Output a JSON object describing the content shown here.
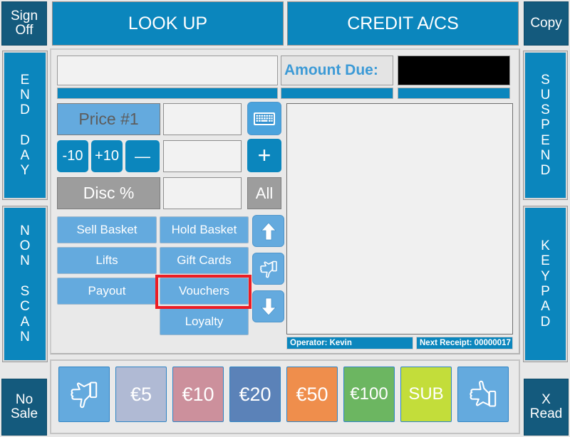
{
  "app": {
    "title": "POS Terminal",
    "colors": {
      "primary_blue": "#0b86bd",
      "light_blue": "#64aade",
      "dark_navy": "#145a7d",
      "disabled_gray": "#9d9d9d",
      "highlight_red": "#ed1c24",
      "panel_gray": "#e9e9e9"
    }
  },
  "corners": {
    "sign_off": "Sign Off",
    "copy": "Copy",
    "no_sale": "No Sale",
    "x_read": "X Read"
  },
  "topbar": {
    "look_up": "LOOK UP",
    "credit_acs": "CREDIT A/CS"
  },
  "sidebar_left": {
    "end_day": "END DAY",
    "non_scan": "NON SCAN"
  },
  "sidebar_right": {
    "suspend": "SUSPEND",
    "keypad": "KEYPAD"
  },
  "entry": {
    "input_value": "",
    "amount_due_label": "Amount Due:",
    "amount_due_value": ""
  },
  "controls": {
    "price_1": "Price #1",
    "minus_ten": "-10",
    "plus_ten": "+10",
    "minus": "—",
    "disc_percent": "Disc %",
    "plus": "+",
    "all": "All",
    "price_1_value": "",
    "qty_value": "",
    "disc_value": "",
    "keyboard_icon": "keyboard-icon",
    "up_icon": "up-arrow-icon",
    "thumbs_down_icon": "thumbs-down-icon",
    "down_icon": "down-arrow-icon"
  },
  "functions": {
    "sell_basket": "Sell Basket",
    "hold_basket": "Hold Basket",
    "lifts": "Lifts",
    "gift_cards": "Gift Cards",
    "payout": "Payout",
    "vouchers": "Vouchers",
    "loyalty": "Loyalty"
  },
  "status": {
    "operator": "Operator: Kevin",
    "next_receipt": "Next Receipt: 00000017"
  },
  "tray": {
    "void_icon": "thumbs-down-icon",
    "confirm_icon": "thumbs-up-icon",
    "denominations": [
      {
        "label": "€5",
        "color": "#b0bad4"
      },
      {
        "label": "€10",
        "color": "#cc909c"
      },
      {
        "label": "€20",
        "color": "#5b82b8"
      },
      {
        "label": "€50",
        "color": "#ef8e4c"
      },
      {
        "label": "€100",
        "color": "#6cb661"
      },
      {
        "label": "SUB",
        "color": "#c3dd3a"
      }
    ]
  }
}
